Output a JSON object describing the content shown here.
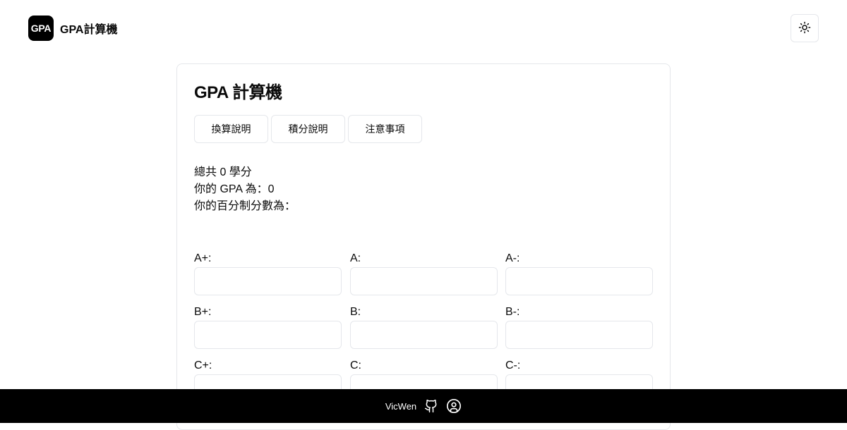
{
  "header": {
    "logo_text": "GPA",
    "title": "GPA計算機",
    "theme_toggle_icon": "sun-icon"
  },
  "card": {
    "title": "GPA 計算機",
    "tabs": [
      {
        "label": "換算說明"
      },
      {
        "label": "積分說明"
      },
      {
        "label": "注意事項"
      }
    ],
    "summary": {
      "total_credits": "總共 0 學分",
      "gpa": "你的 GPA 為：0",
      "percentage": "你的百分制分數為："
    },
    "grades": [
      {
        "label": "A+:",
        "value": "",
        "placeholder": ""
      },
      {
        "label": "A:",
        "value": "",
        "placeholder": ""
      },
      {
        "label": "A-:",
        "value": "",
        "placeholder": ""
      },
      {
        "label": "B+:",
        "value": "",
        "placeholder": ""
      },
      {
        "label": "B:",
        "value": "",
        "placeholder": ""
      },
      {
        "label": "B-:",
        "value": "",
        "placeholder": ""
      },
      {
        "label": "C+:",
        "value": "",
        "placeholder": ""
      },
      {
        "label": "C:",
        "value": "",
        "placeholder": ""
      },
      {
        "label": "C-:",
        "value": "",
        "placeholder": ""
      }
    ]
  },
  "footer": {
    "author": "VicWen",
    "icons": [
      "github-icon",
      "user-circle-icon"
    ]
  },
  "colors": {
    "background": "#ffffff",
    "text": "#0a0a0a",
    "border": "#e5e7eb",
    "footer_bg": "#000000",
    "logo_bg": "#000000"
  }
}
